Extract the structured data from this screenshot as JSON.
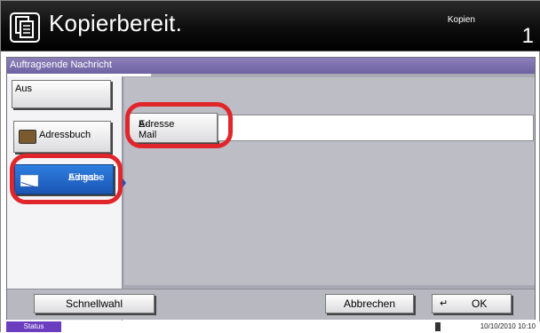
{
  "header": {
    "title": "Kopierbereit.",
    "copies_label": "Kopien",
    "copies_count": "1"
  },
  "panel": {
    "tab_label": "Auftragsende Nachricht",
    "options": {
      "off_label": "Aus",
      "addressbook_label": "Adressbuch",
      "address_entry_label_line1": "Adress-",
      "address_entry_label_line2": "Eingabe"
    },
    "email": {
      "button_line1": "E-Mail",
      "button_line2": "Adresse",
      "value": ""
    }
  },
  "footer": {
    "quick_label": "Schnellwahl",
    "cancel_label": "Abbrechen",
    "ok_label": "OK"
  },
  "status": {
    "status_label": "Status",
    "datetime": "10/10/2010  10:10"
  },
  "colors": {
    "selected": "#1c55b4",
    "tab": "#6e62a2",
    "highlight": "#e0262b",
    "status_badge": "#6b3ec0"
  },
  "icons": {
    "app": "copy-document-icon",
    "addressbook": "book-icon",
    "address_entry": "envelope-icon",
    "ok": "enter-return-icon"
  }
}
